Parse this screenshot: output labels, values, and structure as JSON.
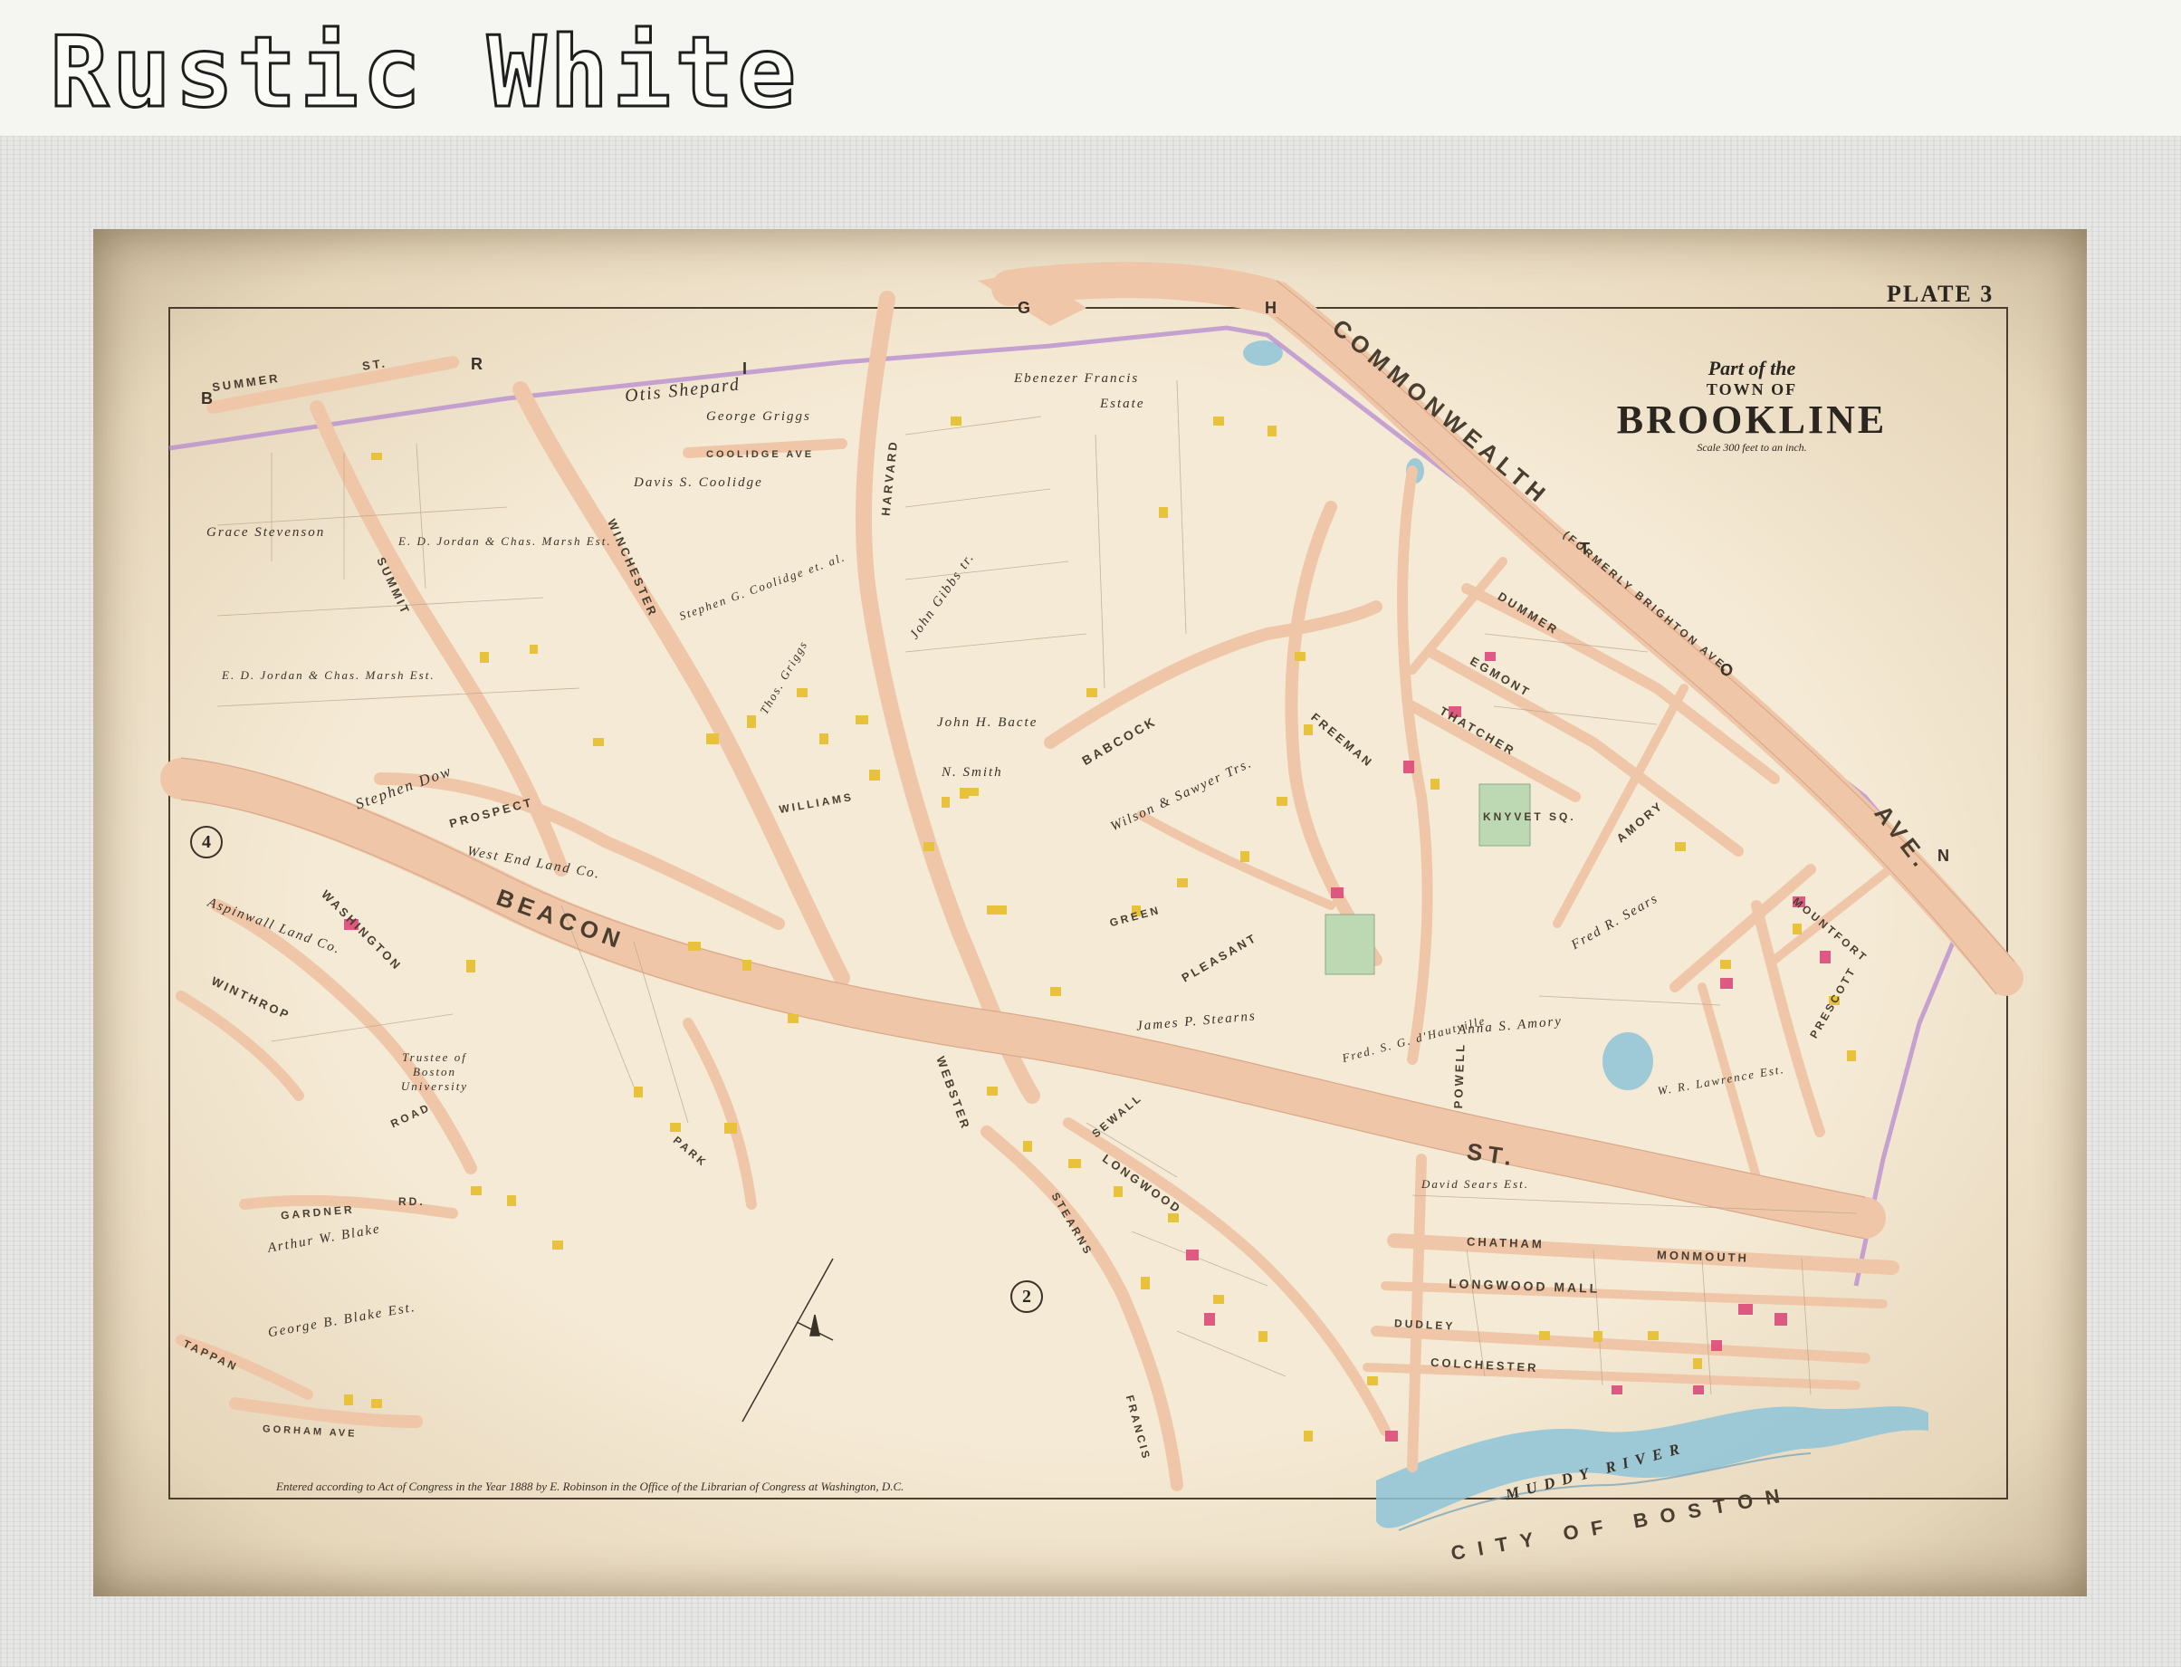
{
  "banner": {
    "title": "Rustic White"
  },
  "plate": {
    "label": "PLATE 3",
    "title_line1": "Part of the",
    "title_line2": "TOWN OF",
    "title_main": "BROOKLINE",
    "scale_text": "Scale 300 feet to an inch."
  },
  "grid_letters": [
    "B",
    "R",
    "I",
    "G",
    "H",
    "T",
    "O",
    "N"
  ],
  "section_numbers": [
    "4",
    "2"
  ],
  "streets": {
    "commonwealth": "COMMONWEALTH",
    "formerly_brighton": "(FORMERLY BRIGHTON AVE.)",
    "beacon": "BEACON",
    "beacon_st": "ST.",
    "summer": "SUMMER",
    "st_top": "ST.",
    "winchester": "WINCHESTER",
    "harvard": "HARVARD",
    "summit": "SUMMIT",
    "prospect": "PROSPECT",
    "washington": "WASHINGTON",
    "winthrop": "WINTHROP",
    "babcock": "BABCOCK",
    "williams": "WILLIAMS",
    "webster": "WEBSTER",
    "green": "GREEN",
    "pleasant": "PLEASANT",
    "powell": "POWELL",
    "freeman": "FREEMAN",
    "dummer": "DUMMER",
    "egmont": "EGMONT",
    "thatcher": "THATCHER",
    "knyvet_sq": "KNYVET SQ.",
    "amory": "AMORY",
    "chatham": "CHATHAM",
    "longwood_mall": "LONGWOOD MALL",
    "monmouth": "MONMOUTH",
    "dudley": "DUDLEY",
    "colchester": "COLCHESTER",
    "francis": "FRANCIS",
    "stearns": "STEARNS",
    "longwood": "LONGWOOD",
    "sewall": "SEWALL",
    "park": "PARK",
    "gardner": "GARDNER",
    "road": "ROAD",
    "rd": "RD.",
    "tappan": "TAPPAN",
    "gorham_ave": "GORHAM AVE",
    "coolidge_ave": "COOLIDGE AVE",
    "mountfort": "MOUNTFORT",
    "prescott": "PRESCOTT",
    "ave": "AVE."
  },
  "owners": {
    "otis_shepard": "Otis Shepard",
    "george_griggs": "George Griggs",
    "ebenezer_francis": "Ebenezer Francis",
    "estate": "Estate",
    "davis_coolidge": "Davis S. Coolidge",
    "grace_stevenson": "Grace Stevenson",
    "jordan_marsh": "E. D. Jordan & Chas. Marsh Est.",
    "jordan_marsh_2": "E. D. Jordan & Chas. Marsh Est.",
    "john_gibbs": "John Gibbs tr.",
    "john_h_bacte": "John H. Bacte",
    "n_smith": "N. Smith",
    "stephen_coolidge": "Stephen G. Coolidge et. al.",
    "thos_griggs": "Thos. Griggs",
    "stephen_dow": "Stephen Dow",
    "west_end_land": "West End Land Co.",
    "aspinwall_land": "Aspinwall Land Co.",
    "trustee_bu": "Trustee of Boston University",
    "arthur_blake": "Arthur W. Blake",
    "george_blake": "George B. Blake Est.",
    "wilson_sawyer": "Wilson & Sawyer Trs.",
    "james_stearns": "James P. Stearns",
    "fred_huntsville": "Fred. S. G. d'Hautville",
    "anna_amory": "Anna S. Amory",
    "fred_sears": "Fred R. Sears",
    "david_sears": "David Sears Est.",
    "wr_lawrence": "W. R. Lawrence Est.",
    "muddy_river": "MUDDY RIVER",
    "city_of_boston": "CITY OF BOSTON"
  },
  "footer": {
    "copyright": "Entered according to Act of Congress in the Year 1888 by E. Robinson in the Office of the Librarian of Congress at Washington, D.C."
  },
  "colors": {
    "paper": "#f3e6cd",
    "road": "#efc7a8",
    "road_edge": "#d9a98a",
    "town_line": "#b58ad0",
    "water": "#8ec4d8",
    "green_square": "#bcd9b3",
    "building_yellow": "#e8c23a",
    "building_pink": "#dc4a7a"
  }
}
